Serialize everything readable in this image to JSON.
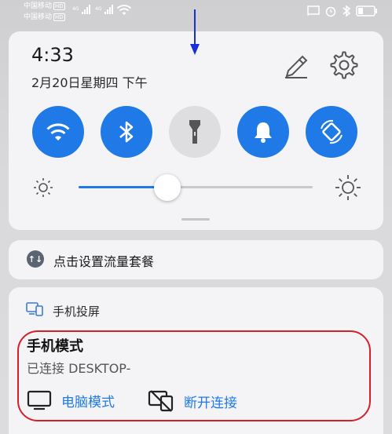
{
  "status_bar": {
    "carrier1": "中国移动",
    "carrier2": "中国移动",
    "hd_badge": "HD",
    "network": "4G"
  },
  "panel": {
    "time": "4:33",
    "date": "2月20日星期四 下午"
  },
  "toggles": [
    {
      "name": "wifi",
      "state": "on"
    },
    {
      "name": "bluetooth",
      "state": "on"
    },
    {
      "name": "flashlight",
      "state": "off"
    },
    {
      "name": "sound",
      "state": "on"
    },
    {
      "name": "auto-rotate",
      "state": "on"
    }
  ],
  "brightness": {
    "level_percent": 38
  },
  "data_plan": {
    "label": "点击设置流量套餐",
    "icon_glyph": "↑↓"
  },
  "projection": {
    "title": "手机投屏",
    "mode": "手机模式",
    "status": "已连接 DESKTOP-",
    "actions": {
      "pc_mode": "电脑模式",
      "disconnect": "断开连接"
    }
  },
  "colors": {
    "accent": "#1f7ae8",
    "highlight": "#d4202b",
    "arrow": "#1b2fd6"
  }
}
